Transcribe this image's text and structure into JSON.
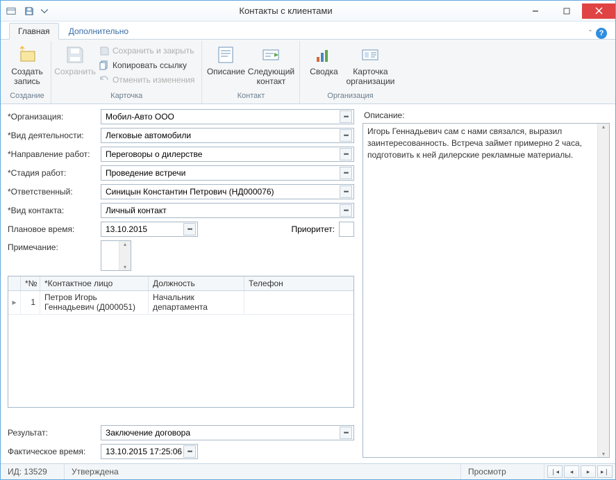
{
  "window": {
    "title": "Контакты с клиентами"
  },
  "ribbonTabs": {
    "main": "Главная",
    "extra": "Дополнительно"
  },
  "ribbon": {
    "create": {
      "label": "Создать\nзапись",
      "group": "Создание"
    },
    "save": {
      "label": "Сохранить"
    },
    "saveClose": "Сохранить и закрыть",
    "copyLink": "Копировать ссылку",
    "undo": "Отменить изменения",
    "cardGroup": "Карточка",
    "desc": {
      "label": "Описание"
    },
    "next": {
      "label": "Следующий\nконтакт"
    },
    "contactGroup": "Контакт",
    "summary": {
      "label": "Сводка"
    },
    "orgCard": {
      "label": "Карточка\nорганизации"
    },
    "orgGroup": "Организация"
  },
  "labels": {
    "org": "*Организация:",
    "activity": "*Вид деятельности:",
    "direction": "*Направление работ:",
    "stage": "*Стадия работ:",
    "responsible": "*Ответственный:",
    "contactType": "*Вид контакта:",
    "plannedTime": "Плановое время:",
    "priority": "Приоритет:",
    "note": "Примечание:",
    "result": "Результат:",
    "actualTime": "Фактическое время:",
    "description": "Описание:"
  },
  "values": {
    "org": "Мобил-Авто ООО",
    "activity": "Легковые автомобили",
    "direction": "Переговоры о дилерстве",
    "stage": "Проведение встречи",
    "responsible": "Синицын Константин Петрович (НД000076)",
    "contactType": "Личный контакт",
    "plannedTime": "13.10.2015",
    "priority": "",
    "note": "",
    "result": "Заключение договора",
    "actualTime": "13.10.2015 17:25:06",
    "description": "Игорь Геннадьевич сам с нами связался, выразил заинтересованность. Встреча займет примерно 2 часа, подготовить к ней дилерские рекламные материалы."
  },
  "grid": {
    "headers": {
      "no": "*№",
      "name": "*Контактное лицо",
      "pos": "Должность",
      "tel": "Телефон"
    },
    "rows": [
      {
        "no": "1",
        "name": "Петров Игорь Геннадьевич (Д000051)",
        "pos": "Начальник департамента",
        "tel": ""
      }
    ]
  },
  "status": {
    "id": "ИД: 13529",
    "state": "Утверждена",
    "mode": "Просмотр"
  }
}
